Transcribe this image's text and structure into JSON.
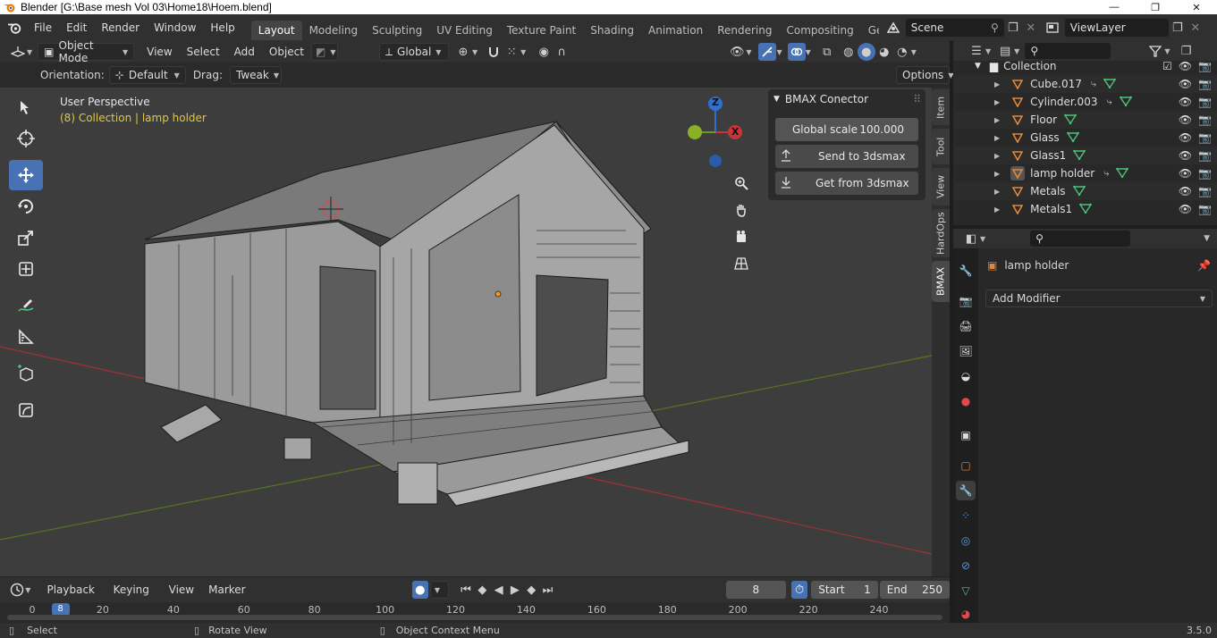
{
  "window": {
    "title": "Blender [G:\\Base mesh Vol 03\\Home18\\Hoem.blend]",
    "minimize": "—",
    "maximize": "❐",
    "close": "✕"
  },
  "menubar": {
    "items": [
      "File",
      "Edit",
      "Render",
      "Window",
      "Help"
    ],
    "workspaces": [
      "Layout",
      "Modeling",
      "Sculpting",
      "UV Editing",
      "Texture Paint",
      "Shading",
      "Animation",
      "Rendering",
      "Compositing",
      "Geometry Noc"
    ],
    "active_workspace": "Layout",
    "scene": "Scene",
    "view_layer": "ViewLayer"
  },
  "viewport_header": {
    "mode": "Object Mode",
    "menus": [
      "View",
      "Select",
      "Add",
      "Object"
    ],
    "transform_orientation": "Global",
    "orientation_label": "Orientation:",
    "orientation_value": "Default",
    "drag_label": "Drag:",
    "drag_value": "Tweak",
    "options": "Options"
  },
  "viewport": {
    "perspective": "User Perspective",
    "collection_info": "(8) Collection | lamp holder",
    "gizmo_axes": [
      "Z",
      "X"
    ]
  },
  "n_panel": {
    "title": "BMAX Conector",
    "global_scale_label": "Global scale",
    "global_scale_value": "100.000",
    "send_button": "Send to 3dsmax",
    "get_button": "Get from 3dsmax",
    "tabs": [
      "Item",
      "Tool",
      "View",
      "HardOps",
      "BMAX"
    ],
    "active_tab": "BMAX"
  },
  "timeline": {
    "menus": [
      "Playback",
      "Keying",
      "View",
      "Marker"
    ],
    "current_frame": "8",
    "start_label": "Start",
    "start_value": "1",
    "end_label": "End",
    "end_value": "250",
    "ruler_ticks": [
      "0",
      "8",
      "20",
      "40",
      "60",
      "80",
      "100",
      "120",
      "140",
      "160",
      "180",
      "200",
      "220",
      "240"
    ],
    "ruler_values": [
      0,
      8,
      20,
      40,
      60,
      80,
      100,
      120,
      140,
      160,
      180,
      200,
      220,
      240
    ]
  },
  "statusbar": {
    "select": "Select",
    "rotate": "Rotate View",
    "context": "Object Context Menu",
    "version": "3.5.0"
  },
  "outliner": {
    "root": "Collection",
    "items": [
      "Cube.017",
      "Cylinder.003",
      "Floor",
      "Glass",
      "Glass1",
      "lamp holder",
      "Metals",
      "Metals1"
    ],
    "active_item": "lamp holder"
  },
  "properties": {
    "object_name": "lamp holder",
    "add_modifier": "Add Modifier"
  },
  "colors": {
    "accent": "#4772b3",
    "viewport_bg": "#3d3d3d",
    "axis_x": "#c8343a",
    "axis_y": "#6a9a22",
    "axis_z": "#2f6fcf",
    "collection_text": "#e0c83a",
    "mesh_icon": "#e0883a",
    "data_icon": "#4ec27a"
  }
}
